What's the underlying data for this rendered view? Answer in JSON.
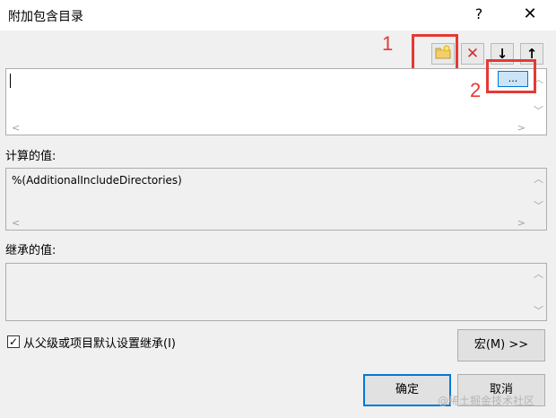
{
  "dialog": {
    "title": "附加包含目录",
    "help": "?",
    "close": "✕"
  },
  "toolbar": {
    "new_folder_icon": "folder-plus-icon",
    "delete_icon": "✕",
    "move_down_icon": "↓",
    "move_up_icon": "↑"
  },
  "annotations": {
    "label1": "1",
    "label2": "2"
  },
  "editor": {
    "value": "",
    "browse_label": "..."
  },
  "computed": {
    "label": "计算的值:",
    "value": "%(AdditionalIncludeDirectories)"
  },
  "inherited": {
    "label": "继承的值:",
    "value": ""
  },
  "inherit_checkbox": {
    "label": "从父级或项目默认设置继承(I)",
    "checked": true
  },
  "buttons": {
    "macros": "宏(M) >>",
    "ok": "确定",
    "cancel": "取消"
  },
  "watermark": "@稀土掘金技术社区",
  "colors": {
    "annotation_red": "#e53935",
    "default_button_border": "#0078d7"
  }
}
